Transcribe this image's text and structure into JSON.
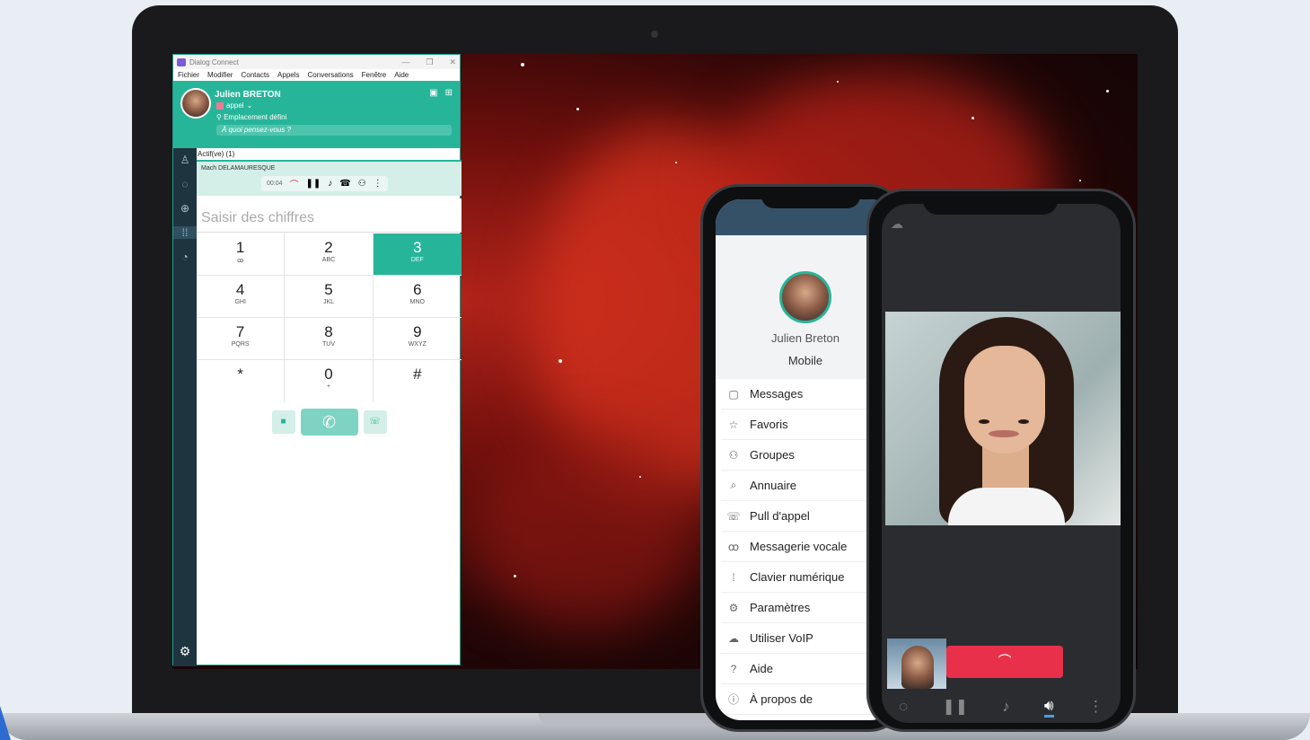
{
  "desktop_app": {
    "window_title": "Dialog Connect",
    "window_controls": [
      "—",
      "❐",
      "✕"
    ],
    "menu": [
      "Fichier",
      "Modifier",
      "Contacts",
      "Appels",
      "Conversations",
      "Fenêtre",
      "Aide"
    ],
    "profile": {
      "name": "Julien BRETON",
      "status": "appel",
      "location": "Emplacement défini",
      "status_message_placeholder": "À quoi pensez-vous ?"
    },
    "active_calls_header": "Actif(ve) (1)",
    "active_call": {
      "caller": "Mach DELAMAURESQUE",
      "timer": "00:04"
    },
    "dial_placeholder": "Saisir des chiffres",
    "keypad": [
      {
        "digit": "1",
        "letters": "ꝏ"
      },
      {
        "digit": "2",
        "letters": "ABC"
      },
      {
        "digit": "3",
        "letters": "DEF"
      },
      {
        "digit": "4",
        "letters": "GHI"
      },
      {
        "digit": "5",
        "letters": "JKL"
      },
      {
        "digit": "6",
        "letters": "MNO"
      },
      {
        "digit": "7",
        "letters": "PQRS"
      },
      {
        "digit": "8",
        "letters": "TUV"
      },
      {
        "digit": "9",
        "letters": "WXYZ"
      },
      {
        "digit": "*",
        "letters": ""
      },
      {
        "digit": "0",
        "letters": "+"
      },
      {
        "digit": "#",
        "letters": ""
      }
    ],
    "highlighted_key": "3",
    "accent_color": "#27b59a"
  },
  "phone_menu": {
    "name": "Julien Breton",
    "subtitle": "Mobile",
    "items": [
      {
        "label": "Messages",
        "icon": "chat-icon"
      },
      {
        "label": "Favoris",
        "icon": "star-icon"
      },
      {
        "label": "Groupes",
        "icon": "group-icon"
      },
      {
        "label": "Annuaire",
        "icon": "search-icon"
      },
      {
        "label": "Pull d'appel",
        "icon": "call-pull-icon"
      },
      {
        "label": "Messagerie vocale",
        "icon": "voicemail-icon"
      },
      {
        "label": "Clavier numérique",
        "icon": "dialpad-icon"
      },
      {
        "label": "Paramètres",
        "icon": "gear-icon"
      },
      {
        "label": "Utiliser VoIP",
        "icon": "cloud-icon"
      },
      {
        "label": "Aide",
        "icon": "help-icon"
      },
      {
        "label": "À propos de",
        "icon": "info-icon"
      }
    ]
  },
  "phone_call": {
    "hangup_color": "#e8304a",
    "bottom_icons": [
      "chat-icon",
      "pause-icon",
      "mute-icon",
      "speaker-icon",
      "more-icon"
    ],
    "active_icon": "speaker-icon"
  }
}
